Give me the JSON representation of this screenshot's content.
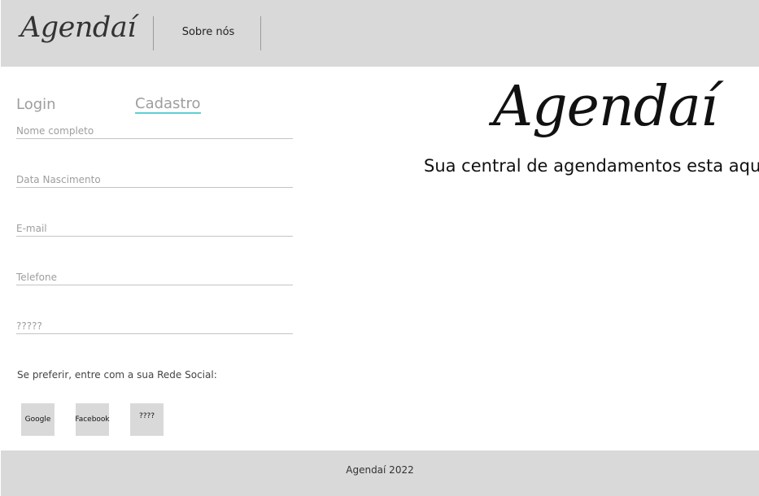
{
  "header": {
    "logo": "Agendaí",
    "nav": {
      "about": "Sobre nós"
    }
  },
  "tabs": {
    "login": "Login",
    "register": "Cadastro",
    "active": "register",
    "active_color": "#5fd0d4"
  },
  "form": {
    "fields": [
      {
        "name": "full-name",
        "placeholder": "Nome completo",
        "value": ""
      },
      {
        "name": "birth-date",
        "placeholder": "Data Nascimento",
        "value": ""
      },
      {
        "name": "email",
        "placeholder": "E-mail",
        "value": ""
      },
      {
        "name": "phone",
        "placeholder": "Telefone",
        "value": ""
      },
      {
        "name": "unknown",
        "placeholder": "?????",
        "value": ""
      }
    ]
  },
  "social": {
    "prompt": "Se preferir, entre com a sua Rede Social:",
    "buttons": [
      "Google",
      "Facebook",
      "????"
    ]
  },
  "hero": {
    "logo": "Agendaí",
    "tagline": "Sua central de agendamentos esta aqui"
  },
  "footer": {
    "text": "Agendaí 2022"
  },
  "colors": {
    "header_bg": "#d9d9d9",
    "footer_bg": "#d9d9d9",
    "accent": "#5fd0d4"
  }
}
